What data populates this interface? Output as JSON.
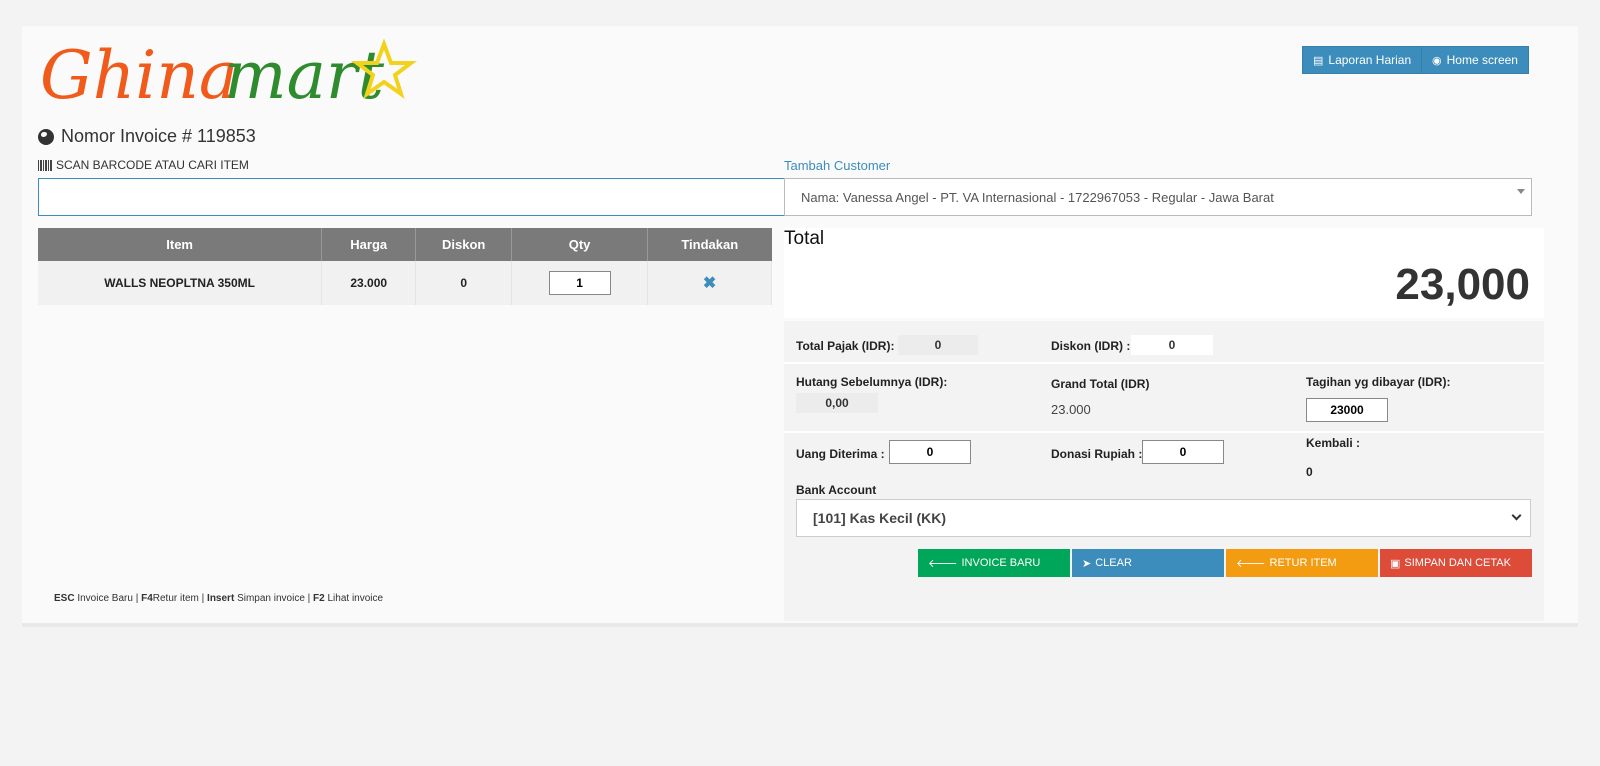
{
  "brand": {
    "logo_text": "Ghinamart",
    "orange": "#f05a1a",
    "green": "#2e8b2e",
    "star": "#f2d21c"
  },
  "header": {
    "laporan_label": "Laporan Harian",
    "home_label": "Home screen"
  },
  "invoice": {
    "title": "Nomor Invoice # 119853"
  },
  "search": {
    "label": "SCAN BARCODE ATAU CARI ITEM",
    "value": ""
  },
  "customer": {
    "add_label": "Tambah Customer",
    "selected": "Nama: Vanessa Angel - PT. VA Internasional - 1722967053 - Regular - Jawa Barat"
  },
  "table": {
    "headers": [
      "Item",
      "Harga",
      "Diskon",
      "Qty",
      "Tindakan"
    ],
    "rows": [
      {
        "item": "WALLS NEOPLTNA 350ML",
        "harga": "23.000",
        "diskon": "0",
        "qty": "1",
        "action": "✖"
      }
    ]
  },
  "totals": {
    "total_label": "Total",
    "total_value": "23,000",
    "pajak_label": "Total Pajak (IDR):",
    "pajak_value": "0",
    "diskon_label": "Diskon (IDR) :",
    "diskon_value": "0",
    "hutang_label": "Hutang Sebelumnya (IDR):",
    "hutang_value": "0,00",
    "grand_label": "Grand Total (IDR)",
    "grand_value": "23.000",
    "tagihan_label": "Tagihan yg dibayar (IDR):",
    "tagihan_value": "23000",
    "uang_label": "Uang Diterima :",
    "uang_value": "0",
    "donasi_label": "Donasi Rupiah :",
    "donasi_value": "0",
    "kembali_label": "Kembali :",
    "kembali_value": "0",
    "bank_label": "Bank Account",
    "bank_value": "[101] Kas Kecil (KK)"
  },
  "actions": {
    "invoice_baru": "INVOICE BARU",
    "clear": "CLEAR",
    "retur": "RETUR ITEM",
    "simpan": "SIMPAN DAN CETAK"
  },
  "shortcuts": [
    {
      "key": "ESC",
      "desc": "Invoice Baru"
    },
    {
      "key": "F4",
      "desc": "Retur item"
    },
    {
      "key": "Insert",
      "desc": "Simpan invoice"
    },
    {
      "key": "F2",
      "desc": "Lihat invoice"
    }
  ]
}
